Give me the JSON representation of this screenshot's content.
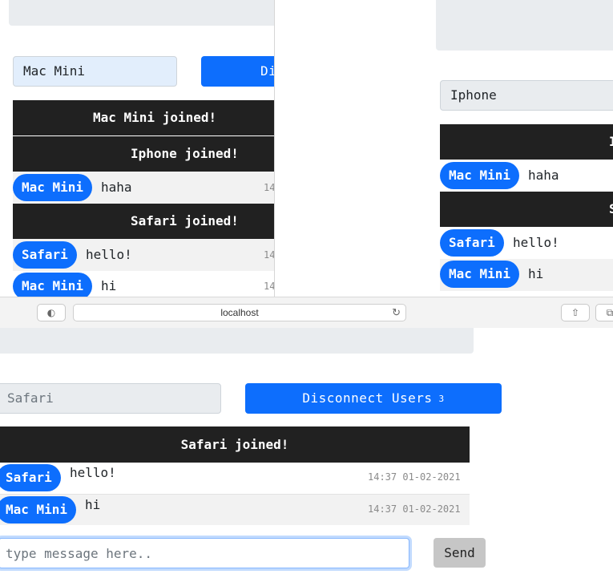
{
  "window_a": {
    "username": "Mac Mini",
    "disconnect_partial": "Di",
    "notices": [
      "Mac Mini joined!",
      "Iphone joined!",
      "Safari joined!"
    ],
    "messages": [
      {
        "user": "Mac Mini",
        "text": "haha",
        "ts": "14"
      },
      {
        "user": "Safari",
        "text": "hello!",
        "ts": "14"
      },
      {
        "user": "Mac Mini",
        "text": "hi",
        "ts": "14"
      }
    ]
  },
  "window_b": {
    "username": "Iphone",
    "notice_partial_1": "I",
    "notice_partial_2": "S",
    "messages": [
      {
        "user": "Mac Mini",
        "text": "haha"
      },
      {
        "user": "Safari",
        "text": "hello!"
      },
      {
        "user": "Mac Mini",
        "text": "hi"
      }
    ]
  },
  "browser": {
    "address": "localhost",
    "icons": [
      "sidebar-icon",
      "reload-icon",
      "share-icon",
      "tabs-icon"
    ]
  },
  "window_c": {
    "username_placeholder": "Safari",
    "disconnect_label": "Disconnect Users",
    "user_count": "3",
    "notice": "Safari joined!",
    "messages": [
      {
        "user": "Safari",
        "text": "hello!",
        "ts": "14:37 01-02-2021"
      },
      {
        "user": "Mac Mini",
        "text": "hi",
        "ts": "14:37 01-02-2021"
      }
    ],
    "input_placeholder": "type message here..",
    "send_label": "Send"
  },
  "colors": {
    "primary": "#0d6efd",
    "notice_bg": "#212121",
    "field_bg": "#e9ecef",
    "send_bg": "#c6c6c6"
  }
}
